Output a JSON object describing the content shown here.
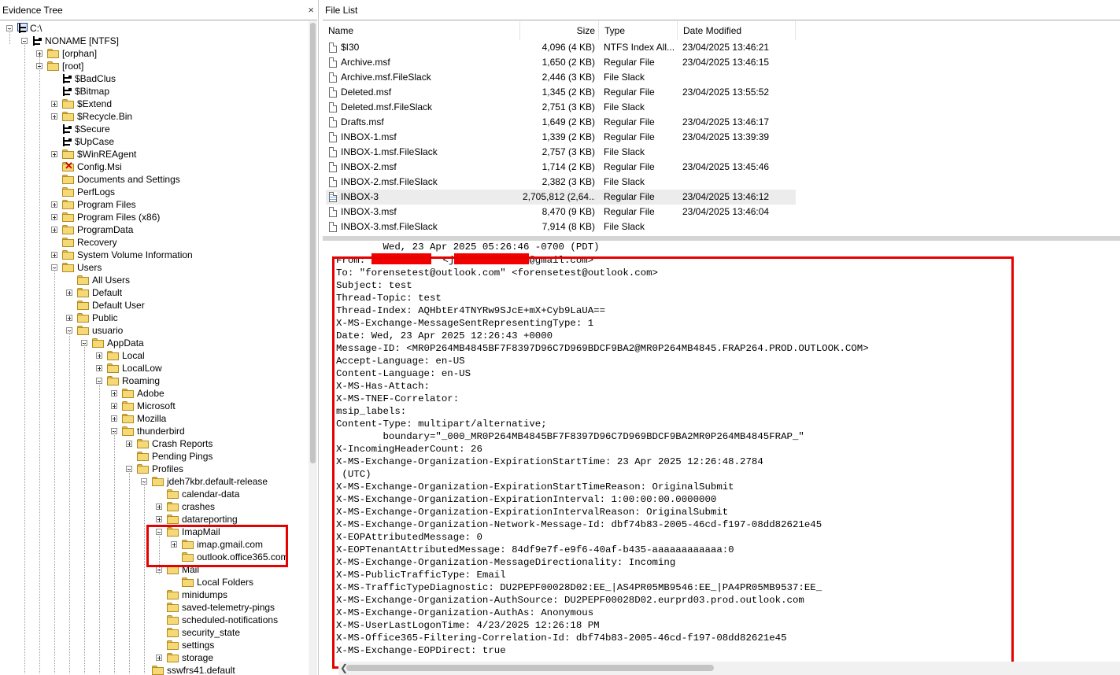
{
  "tree_pane": {
    "title": "Evidence Tree",
    "close": "×"
  },
  "tree": [
    {
      "label": "C:\\",
      "icon": "drive-icon",
      "toggle": "minus"
    },
    {
      "label": "NONAME [NTFS]",
      "icon": "ntfs-icon",
      "toggle": "minus"
    },
    {
      "label": "[orphan]",
      "icon": "folder-icon",
      "toggle": "plus"
    },
    {
      "label": "[root]",
      "icon": "folder-icon",
      "toggle": "minus"
    },
    {
      "label": "$BadClus",
      "icon": "mft-icon",
      "toggle": ""
    },
    {
      "label": "$Bitmap",
      "icon": "mft-icon",
      "toggle": ""
    },
    {
      "label": "$Extend",
      "icon": "folder-icon",
      "toggle": "plus"
    },
    {
      "label": "$Recycle.Bin",
      "icon": "folder-icon",
      "toggle": "plus"
    },
    {
      "label": "$Secure",
      "icon": "mft-icon",
      "toggle": ""
    },
    {
      "label": "$UpCase",
      "icon": "mft-icon",
      "toggle": ""
    },
    {
      "label": "$WinREAgent",
      "icon": "folder-icon",
      "toggle": "plus"
    },
    {
      "label": "Config.Msi",
      "icon": "deleted-folder-icon",
      "toggle": ""
    },
    {
      "label": "Documents and Settings",
      "icon": "folder-icon",
      "toggle": ""
    },
    {
      "label": "PerfLogs",
      "icon": "folder-icon",
      "toggle": ""
    },
    {
      "label": "Program Files",
      "icon": "folder-icon",
      "toggle": "plus"
    },
    {
      "label": "Program Files (x86)",
      "icon": "folder-icon",
      "toggle": "plus"
    },
    {
      "label": "ProgramData",
      "icon": "folder-icon",
      "toggle": "plus"
    },
    {
      "label": "Recovery",
      "icon": "folder-icon",
      "toggle": ""
    },
    {
      "label": "System Volume Information",
      "icon": "folder-icon",
      "toggle": "plus"
    },
    {
      "label": "Users",
      "icon": "folder-icon",
      "toggle": "minus"
    },
    {
      "label": "All Users",
      "icon": "folder-icon",
      "toggle": ""
    },
    {
      "label": "Default",
      "icon": "folder-icon",
      "toggle": "plus"
    },
    {
      "label": "Default User",
      "icon": "folder-icon",
      "toggle": ""
    },
    {
      "label": "Public",
      "icon": "folder-icon",
      "toggle": "plus"
    },
    {
      "label": "usuario",
      "icon": "folder-icon",
      "toggle": "minus"
    },
    {
      "label": "AppData",
      "icon": "folder-icon",
      "toggle": "minus"
    },
    {
      "label": "Local",
      "icon": "folder-icon",
      "toggle": "plus"
    },
    {
      "label": "LocalLow",
      "icon": "folder-icon",
      "toggle": "plus"
    },
    {
      "label": "Roaming",
      "icon": "folder-icon",
      "toggle": "minus"
    },
    {
      "label": "Adobe",
      "icon": "folder-icon",
      "toggle": "plus"
    },
    {
      "label": "Microsoft",
      "icon": "folder-icon",
      "toggle": "plus"
    },
    {
      "label": "Mozilla",
      "icon": "folder-icon",
      "toggle": "plus"
    },
    {
      "label": "thunderbird",
      "icon": "folder-icon",
      "toggle": "minus"
    },
    {
      "label": "Crash Reports",
      "icon": "folder-icon",
      "toggle": "plus"
    },
    {
      "label": "Pending Pings",
      "icon": "folder-icon",
      "toggle": ""
    },
    {
      "label": "Profiles",
      "icon": "folder-icon",
      "toggle": "minus"
    },
    {
      "label": "jdeh7kbr.default-release",
      "icon": "folder-icon",
      "toggle": "minus"
    },
    {
      "label": "calendar-data",
      "icon": "folder-icon",
      "toggle": ""
    },
    {
      "label": "crashes",
      "icon": "folder-icon",
      "toggle": "plus"
    },
    {
      "label": "datareporting",
      "icon": "folder-icon",
      "toggle": "plus"
    },
    {
      "label": "ImapMail",
      "icon": "folder-icon",
      "toggle": "minus"
    },
    {
      "label": "imap.gmail.com",
      "icon": "folder-icon",
      "toggle": "plus"
    },
    {
      "label": "outlook.office365.com",
      "icon": "folder-icon",
      "toggle": ""
    },
    {
      "label": "Mail",
      "icon": "folder-icon",
      "toggle": "minus"
    },
    {
      "label": "Local Folders",
      "icon": "folder-icon",
      "toggle": ""
    },
    {
      "label": "minidumps",
      "icon": "folder-icon",
      "toggle": ""
    },
    {
      "label": "saved-telemetry-pings",
      "icon": "folder-icon",
      "toggle": ""
    },
    {
      "label": "scheduled-notifications",
      "icon": "folder-icon",
      "toggle": ""
    },
    {
      "label": "security_state",
      "icon": "folder-icon",
      "toggle": ""
    },
    {
      "label": "settings",
      "icon": "folder-icon",
      "toggle": ""
    },
    {
      "label": "storage",
      "icon": "folder-icon",
      "toggle": "plus"
    },
    {
      "label": "sswfrs41.default",
      "icon": "folder-icon",
      "toggle": ""
    }
  ],
  "file_list": {
    "title": "File List",
    "columns": [
      "Name",
      "Size",
      "Type",
      "Date Modified"
    ],
    "rows": [
      {
        "name": "$I30",
        "size": "4,096 (4 KB)",
        "type": "NTFS Index All...",
        "date": "23/04/2025 13:46:21",
        "selected": false
      },
      {
        "name": "Archive.msf",
        "size": "1,650 (2 KB)",
        "type": "Regular File",
        "date": "23/04/2025 13:46:15",
        "selected": false
      },
      {
        "name": "Archive.msf.FileSlack",
        "size": "2,446 (3 KB)",
        "type": "File Slack",
        "date": "",
        "selected": false
      },
      {
        "name": "Deleted.msf",
        "size": "1,345 (2 KB)",
        "type": "Regular File",
        "date": "23/04/2025 13:55:52",
        "selected": false
      },
      {
        "name": "Deleted.msf.FileSlack",
        "size": "2,751 (3 KB)",
        "type": "File Slack",
        "date": "",
        "selected": false
      },
      {
        "name": "Drafts.msf",
        "size": "1,649 (2 KB)",
        "type": "Regular File",
        "date": "23/04/2025 13:46:17",
        "selected": false
      },
      {
        "name": "INBOX-1.msf",
        "size": "1,339 (2 KB)",
        "type": "Regular File",
        "date": "23/04/2025 13:39:39",
        "selected": false
      },
      {
        "name": "INBOX-1.msf.FileSlack",
        "size": "2,757 (3 KB)",
        "type": "File Slack",
        "date": "",
        "selected": false
      },
      {
        "name": "INBOX-2.msf",
        "size": "1,714 (2 KB)",
        "type": "Regular File",
        "date": "23/04/2025 13:45:46",
        "selected": false
      },
      {
        "name": "INBOX-2.msf.FileSlack",
        "size": "2,382 (3 KB)",
        "type": "File Slack",
        "date": "",
        "selected": false
      },
      {
        "name": "INBOX-3",
        "size": "2,705,812 (2,64...",
        "type": "Regular File",
        "date": "23/04/2025 13:46:12",
        "selected": true
      },
      {
        "name": "INBOX-3.msf",
        "size": "8,470 (9 KB)",
        "type": "Regular File",
        "date": "23/04/2025 13:46:04",
        "selected": false
      },
      {
        "name": "INBOX-3.msf.FileSlack",
        "size": "7,914 (8 KB)",
        "type": "File Slack",
        "date": "",
        "selected": false
      }
    ]
  },
  "message": {
    "cut_line": "        Wed, 23 Apr 2025 05:26:46 -0700 (PDT)",
    "from_prefix": "From: ",
    "from_mid": "  <j",
    "from_suffix": "@gmail.com>",
    "lines": [
      "To: \"forensetest@outlook.com\" <forensetest@outlook.com>",
      "Subject: test",
      "Thread-Topic: test",
      "Thread-Index: AQHbtEr4TNYRw9SJcE+mX+Cyb9LaUA==",
      "X-MS-Exchange-MessageSentRepresentingType: 1",
      "Date: Wed, 23 Apr 2025 12:26:43 +0000",
      "Message-ID: <MR0P264MB4845BF7F8397D96C7D969BDCF9BA2@MR0P264MB4845.FRAP264.PROD.OUTLOOK.COM>",
      "Accept-Language: en-US",
      "Content-Language: en-US",
      "X-MS-Has-Attach:",
      "X-MS-TNEF-Correlator:",
      "msip_labels:",
      "Content-Type: multipart/alternative;",
      "        boundary=\"_000_MR0P264MB4845BF7F8397D96C7D969BDCF9BA2MR0P264MB4845FRAP_\"",
      "X-IncomingHeaderCount: 26",
      "X-MS-Exchange-Organization-ExpirationStartTime: 23 Apr 2025 12:26:48.2784",
      " (UTC)",
      "X-MS-Exchange-Organization-ExpirationStartTimeReason: OriginalSubmit",
      "X-MS-Exchange-Organization-ExpirationInterval: 1:00:00:00.0000000",
      "X-MS-Exchange-Organization-ExpirationIntervalReason: OriginalSubmit",
      "X-MS-Exchange-Organization-Network-Message-Id: dbf74b83-2005-46cd-f197-08dd82621e45",
      "X-EOPAttributedMessage: 0",
      "X-EOPTenantAttributedMessage: 84df9e7f-e9f6-40af-b435-aaaaaaaaaaaa:0",
      "X-MS-Exchange-Organization-MessageDirectionality: Incoming",
      "X-MS-PublicTrafficType: Email",
      "X-MS-TrafficTypeDiagnostic: DU2PEPF00028D02:EE_|AS4PR05MB9546:EE_|PA4PR05MB9537:EE_",
      "X-MS-Exchange-Organization-AuthSource: DU2PEPF00028D02.eurprd03.prod.outlook.com",
      "X-MS-Exchange-Organization-AuthAs: Anonymous",
      "X-MS-UserLastLogonTime: 4/23/2025 12:26:18 PM",
      "X-MS-Office365-Filtering-Correlation-Id: dbf74b83-2005-46cd-f197-08dd82621e45",
      "X-MS-Exchange-EOPDirect: true"
    ]
  },
  "colors": {
    "highlight_box": "#e60000",
    "redaction": "#f10000",
    "folder": "#f6d977",
    "selected_row": "#ececec"
  }
}
